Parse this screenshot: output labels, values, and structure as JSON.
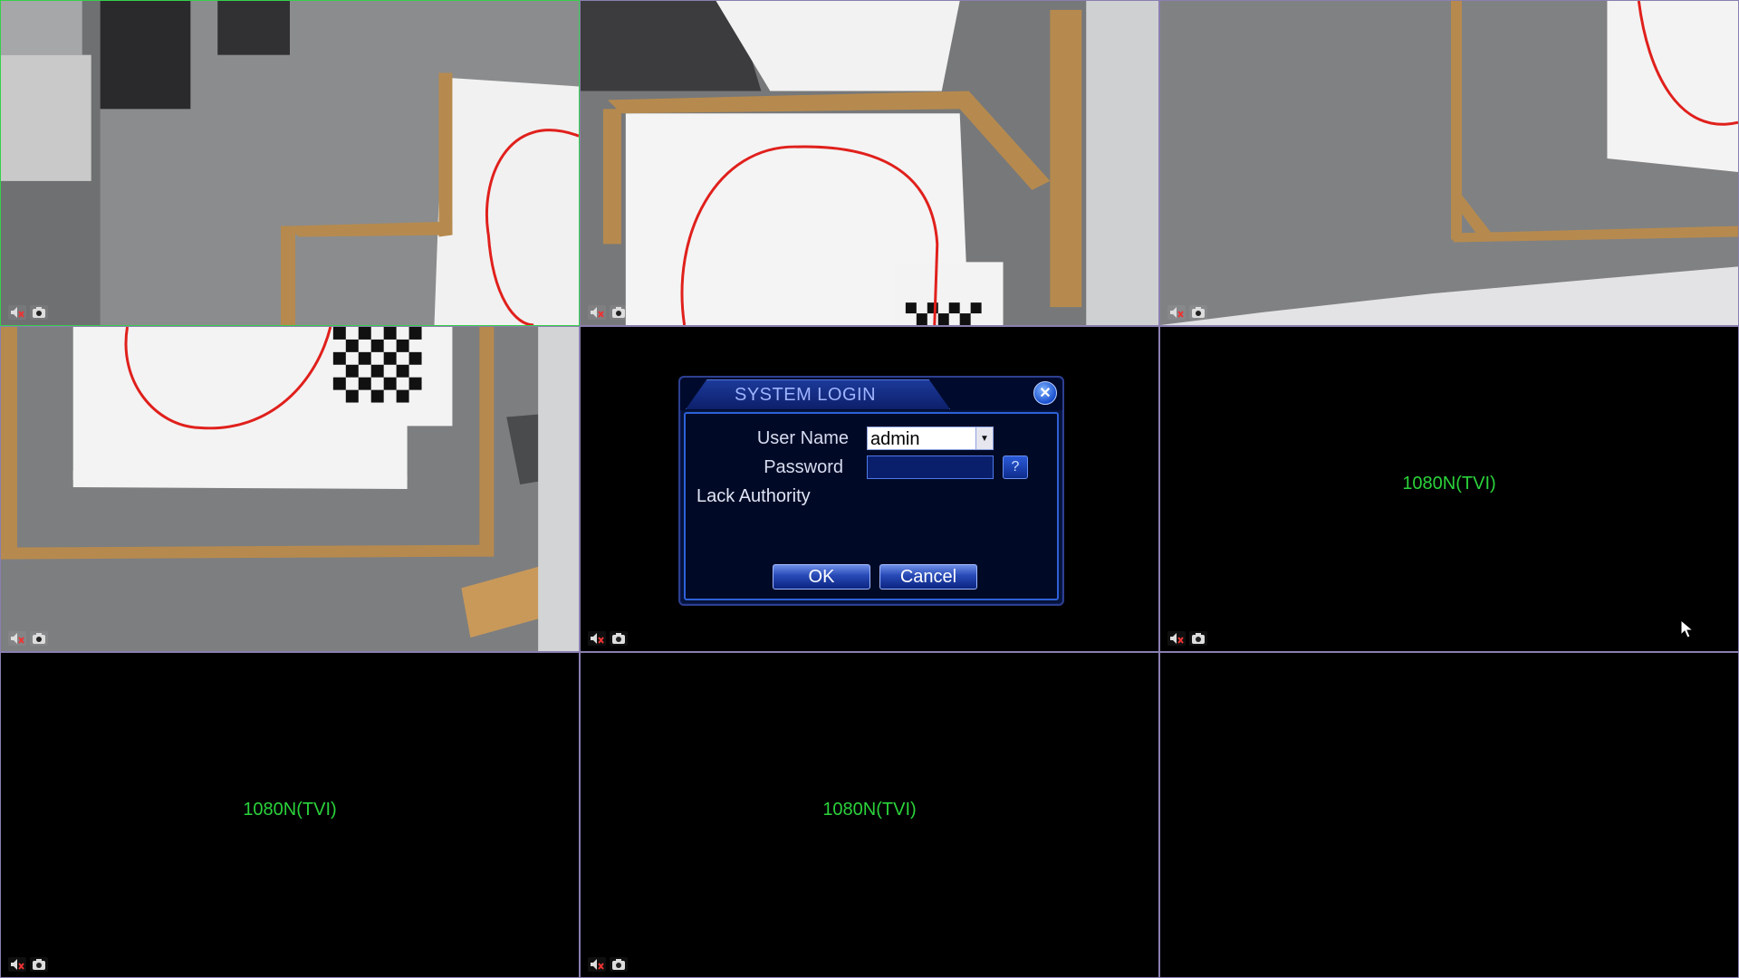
{
  "channels": [
    {
      "id": 1,
      "kind": "camera",
      "label": ""
    },
    {
      "id": 2,
      "kind": "camera",
      "label": ""
    },
    {
      "id": 3,
      "kind": "camera",
      "label": ""
    },
    {
      "id": 4,
      "kind": "camera",
      "label": ""
    },
    {
      "id": 5,
      "kind": "login",
      "label": ""
    },
    {
      "id": 6,
      "kind": "blank",
      "label": "1080N(TVI)"
    },
    {
      "id": 7,
      "kind": "blank",
      "label": "1080N(TVI)"
    },
    {
      "id": 8,
      "kind": "blank",
      "label": "1080N(TVI)"
    },
    {
      "id": 9,
      "kind": "blank",
      "label": ""
    }
  ],
  "tile_icons": [
    "mute-speaker-icon",
    "camera-snapshot-icon"
  ],
  "dialog": {
    "title": "SYSTEM LOGIN",
    "close_glyph": "✕",
    "user_name_label": "User Name",
    "user_name_value": "admin",
    "password_label": "Password",
    "password_value": "",
    "help_glyph": "?",
    "status_message": "Lack Authority",
    "ok_label": "OK",
    "cancel_label": "Cancel"
  },
  "colors": {
    "selected_border": "#35d04a",
    "tile_border": "#8a7fb0",
    "channel_text": "#2bd23b",
    "dialog_bg": "#06143a",
    "track_line": "#e0201c"
  }
}
